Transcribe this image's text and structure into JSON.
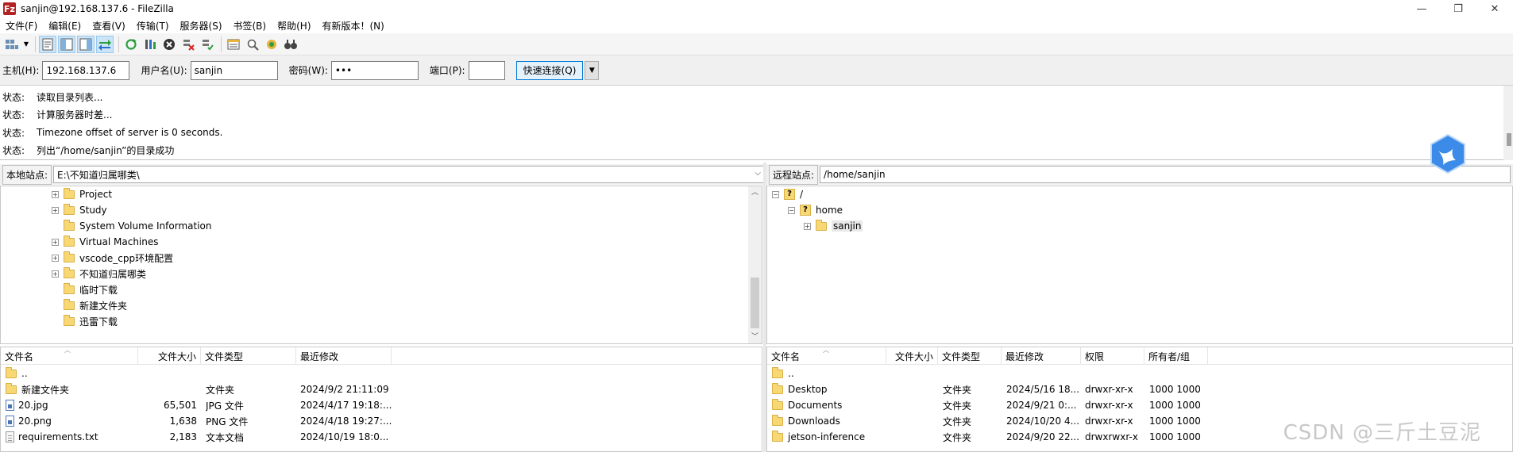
{
  "window": {
    "title": "sanjin@192.168.137.6 - FileZilla",
    "app_icon": "Fz",
    "minimize": "—",
    "maximize": "❐",
    "close": "✕"
  },
  "menu": [
    "文件(F)",
    "编辑(E)",
    "查看(V)",
    "传输(T)",
    "服务器(S)",
    "书签(B)",
    "帮助(H)",
    "有新版本！(N)"
  ],
  "toolbar": {
    "icons": [
      "site-manager-icon",
      "dropdown-icon",
      "message-log-icon",
      "local-tree-icon",
      "remote-tree-icon",
      "transfer-queue-icon",
      "refresh-icon",
      "process-queue-icon",
      "cancel-icon",
      "disconnect-icon",
      "reconnect-icon",
      "directory-listing-icon",
      "filter-icon",
      "sync-browse-icon",
      "search-icon"
    ]
  },
  "quickconnect": {
    "host_label": "主机(H):",
    "host_value": "192.168.137.6",
    "user_label": "用户名(U):",
    "user_value": "sanjin",
    "pass_label": "密码(W):",
    "pass_value": "•••",
    "port_label": "端口(P):",
    "port_value": "",
    "connect_button": "快速连接(Q)",
    "dropdown": "▼"
  },
  "log": [
    {
      "type": "状态:",
      "msg": "读取目录列表..."
    },
    {
      "type": "状态:",
      "msg": "计算服务器时差..."
    },
    {
      "type": "状态:",
      "msg": "Timezone offset of server is 0 seconds."
    },
    {
      "type": "状态:",
      "msg": "列出“/home/sanjin”的目录成功"
    }
  ],
  "local": {
    "site_label": "本地站点:",
    "path": "E:\\不知道归属哪类\\",
    "tree": [
      {
        "name": "Project",
        "expander": "+"
      },
      {
        "name": "Study",
        "expander": "+"
      },
      {
        "name": "System Volume Information",
        "expander": ""
      },
      {
        "name": "Virtual Machines",
        "expander": "+"
      },
      {
        "name": "vscode_cpp环境配置",
        "expander": "+"
      },
      {
        "name": "不知道归属哪类",
        "expander": "+"
      },
      {
        "name": "临时下载",
        "expander": ""
      },
      {
        "name": "新建文件夹",
        "expander": ""
      },
      {
        "name": "迅雷下载",
        "expander": ""
      }
    ],
    "columns": [
      "文件名",
      "文件大小",
      "文件类型",
      "最近修改"
    ],
    "files": [
      {
        "name": "..",
        "size": "",
        "type": "",
        "modified": "",
        "icon": "folder"
      },
      {
        "name": "新建文件夹",
        "size": "",
        "type": "文件夹",
        "modified": "2024/9/2 21:11:09",
        "icon": "folder"
      },
      {
        "name": "20.jpg",
        "size": "65,501",
        "type": "JPG 文件",
        "modified": "2024/4/17 19:18:...",
        "icon": "img"
      },
      {
        "name": "20.png",
        "size": "1,638",
        "type": "PNG 文件",
        "modified": "2024/4/18 19:27:...",
        "icon": "img"
      },
      {
        "name": "requirements.txt",
        "size": "2,183",
        "type": "文本文档",
        "modified": "2024/10/19 18:0...",
        "icon": "txt"
      }
    ]
  },
  "remote": {
    "site_label": "远程站点:",
    "path": "/home/sanjin",
    "tree": [
      {
        "name": "/",
        "expander": "−",
        "icon": "?"
      },
      {
        "name": "home",
        "expander": "−",
        "icon": "?"
      },
      {
        "name": "sanjin",
        "expander": "+",
        "icon": "folder"
      }
    ],
    "columns": [
      "文件名",
      "文件大小",
      "文件类型",
      "最近修改",
      "权限",
      "所有者/组"
    ],
    "files": [
      {
        "name": "..",
        "size": "",
        "type": "",
        "modified": "",
        "perm": "",
        "owner": ""
      },
      {
        "name": "Desktop",
        "size": "",
        "type": "文件夹",
        "modified": "2024/5/16 18...",
        "perm": "drwxr-xr-x",
        "owner": "1000 1000"
      },
      {
        "name": "Documents",
        "size": "",
        "type": "文件夹",
        "modified": "2024/9/21 0:...",
        "perm": "drwxr-xr-x",
        "owner": "1000 1000"
      },
      {
        "name": "Downloads",
        "size": "",
        "type": "文件夹",
        "modified": "2024/10/20 4...",
        "perm": "drwxr-xr-x",
        "owner": "1000 1000"
      },
      {
        "name": "jetson-inference",
        "size": "",
        "type": "文件夹",
        "modified": "2024/9/20 22...",
        "perm": "drwxrwxr-x",
        "owner": "1000 1000"
      }
    ]
  },
  "watermark": "CSDN @三斤土豆泥"
}
